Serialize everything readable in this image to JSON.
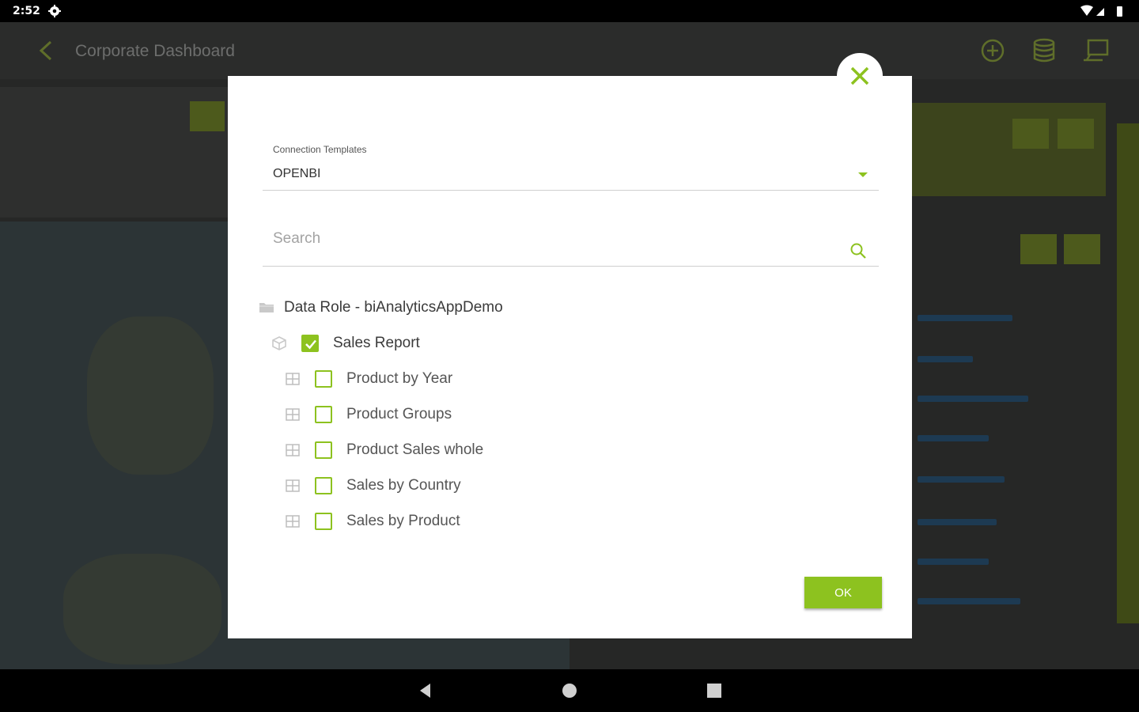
{
  "status_bar": {
    "time": "2:52"
  },
  "app_bar": {
    "title": "Corporate Dashboard"
  },
  "dialog": {
    "connection_templates_label": "Connection Templates",
    "connection_templates_value": "OPENBI",
    "search_placeholder": "Search",
    "ok_label": "OK",
    "tree": {
      "root": {
        "label": "Data Role - biAnalyticsAppDemo",
        "icon": "folder-icon"
      },
      "report": {
        "label": "Sales Report",
        "checked": true,
        "icon": "cube-icon"
      },
      "items": [
        {
          "label": "Product by Year",
          "checked": false,
          "icon": "table-icon"
        },
        {
          "label": "Product Groups",
          "checked": false,
          "icon": "table-icon"
        },
        {
          "label": "Product Sales whole",
          "checked": false,
          "icon": "table-icon"
        },
        {
          "label": "Sales by Country",
          "checked": false,
          "icon": "table-icon"
        },
        {
          "label": "Sales by Product",
          "checked": false,
          "icon": "table-icon"
        }
      ]
    }
  },
  "colors": {
    "accent": "#8dc21f",
    "overlay": "#1e1f1e"
  }
}
